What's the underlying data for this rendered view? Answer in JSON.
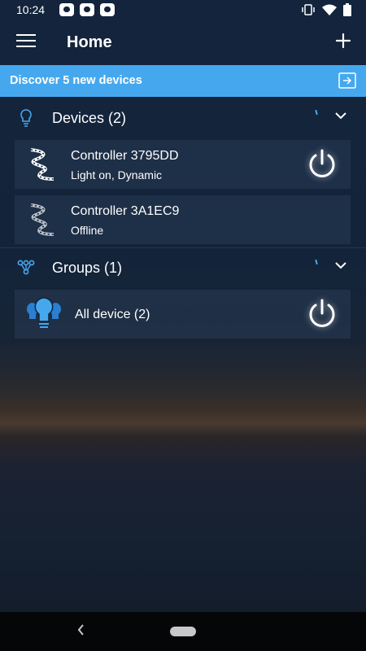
{
  "status_bar": {
    "time": "10:24",
    "icons": [
      "chat-notification-icon",
      "chat-notification-icon",
      "chat-notification-icon",
      "vibrate-icon",
      "wifi-icon",
      "battery-icon"
    ]
  },
  "app_bar": {
    "title": "Home",
    "menu_icon": "menu-icon",
    "add_icon": "add-icon"
  },
  "banner": {
    "text": "Discover 5 new devices",
    "icon": "arrow-right-box-icon"
  },
  "devices_section": {
    "title": "Devices (2)",
    "icon": "lightbulb-outline-icon",
    "items": [
      {
        "name": "Controller  3795DD",
        "status": "Light on, Dynamic",
        "icon": "led-strip-icon",
        "online": true
      },
      {
        "name": "Controller  3A1EC9",
        "status": "Offline",
        "icon": "led-strip-icon",
        "online": false
      }
    ]
  },
  "groups_section": {
    "title": "Groups (1)",
    "icon": "group-nodes-icon",
    "items": [
      {
        "name": "All device (2)",
        "icon": "bulb-group-icon"
      }
    ]
  },
  "colors": {
    "accent": "#45a8ef",
    "background_top": "#13243c",
    "card": "#283a54"
  }
}
